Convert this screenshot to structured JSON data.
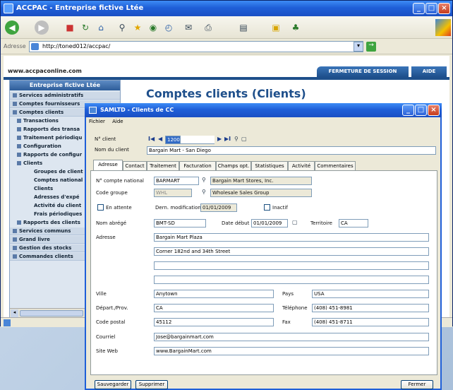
{
  "browser": {
    "title": "ACCPAC - Entreprise fictive Ltée",
    "address_label": "Adresse",
    "url": "http://toned012/accpac/",
    "min_label": "_",
    "max_label": "□",
    "close_label": "×",
    "toolbar_icons": [
      "back-icon",
      "forward-icon",
      "stop-icon",
      "refresh-icon",
      "home-icon",
      "search-icon",
      "favorites-icon",
      "media-icon",
      "history-icon",
      "mail-icon",
      "print-icon",
      "edit-icon",
      "discuss-icon",
      "messenger-icon"
    ]
  },
  "site": {
    "url_text": "www.accpaconline.com",
    "logout_label": "FERMETURE DE SESSION",
    "help_label": "AIDE",
    "page_title": "Comptes clients (Clients)"
  },
  "sidebar": {
    "header": "Entreprise fictive Ltée",
    "items": [
      {
        "label": "Services administratifs",
        "level": 0
      },
      {
        "label": "Comptes fournisseurs",
        "level": 0
      },
      {
        "label": "Comptes clients",
        "level": 0
      },
      {
        "label": "Transactions",
        "level": 1
      },
      {
        "label": "Rapports des transa",
        "level": 1
      },
      {
        "label": "Traitement périodiqu",
        "level": 1
      },
      {
        "label": "Configuration",
        "level": 1
      },
      {
        "label": "Rapports de configur",
        "level": 1
      },
      {
        "label": "Clients",
        "level": 1
      },
      {
        "label": "Groupes de client",
        "level": 2
      },
      {
        "label": "Comptes national",
        "level": 2
      },
      {
        "label": "Clients",
        "level": 2
      },
      {
        "label": "Adresses d'expé",
        "level": 2
      },
      {
        "label": "Activité du client",
        "level": 2
      },
      {
        "label": "Frais périodiques",
        "level": 2
      },
      {
        "label": "Rapports des clients",
        "level": 1
      },
      {
        "label": "Services communs",
        "level": 0
      },
      {
        "label": "Grand livre",
        "level": 0
      },
      {
        "label": "Gestion des stocks",
        "level": 0
      },
      {
        "label": "Commandes clients",
        "level": 0
      }
    ]
  },
  "dialog": {
    "title": "SAMLTD - Clients de CC",
    "menu": [
      "Fichier",
      "Aide"
    ],
    "customer_no_label": "N° client",
    "customer_no": "1200",
    "customer_name_label": "Nom du client",
    "customer_name": "Bargain Mart - San Diego",
    "tabs": [
      "Adresse",
      "Contact",
      "Traitement",
      "Facturation",
      "Champs opt.",
      "Statistiques",
      "Activité",
      "Commentaires"
    ],
    "active_tab": 0,
    "national_account_label": "N° compte national",
    "national_account": "BARMART",
    "national_account_desc": "Bargain Mart Stores, Inc.",
    "group_code_label": "Code groupe",
    "group_code": "WHL",
    "group_code_desc": "Wholesale Sales Group",
    "on_hold_label": "En attente",
    "last_mod_label": "Dern. modification",
    "last_mod": "01/01/2009",
    "inactive_label": "Inactif",
    "short_name_label": "Nom abrégé",
    "short_name": "BMT-SD",
    "start_date_label": "Date début",
    "start_date": "01/01/2009",
    "territory_label": "Territoire",
    "territory": "CA",
    "address_label": "Adresse",
    "address_lines": [
      "Bargain Mart Plaza",
      "Corner 182nd and 34th Street",
      "",
      ""
    ],
    "city_label": "Ville",
    "city": "Anytown",
    "country_label": "Pays",
    "country": "USA",
    "state_label": "Départ./Prov.",
    "state": "CA",
    "phone_label": "Téléphone",
    "phone": "(408) 451-8981",
    "zip_label": "Code postal",
    "zip": "45112",
    "fax_label": "Fax",
    "fax": "(408) 451-8711",
    "email_label": "Courriel",
    "email": "Jose@bargainmart.com",
    "web_label": "Site Web",
    "web": "www.BargainMart.com",
    "save_label": "Sauvegarder",
    "delete_label": "Supprimer",
    "close_label": "Fermer",
    "nav_first": "I◀",
    "nav_prev": "◀",
    "nav_next": "▶",
    "nav_last": "▶I"
  }
}
